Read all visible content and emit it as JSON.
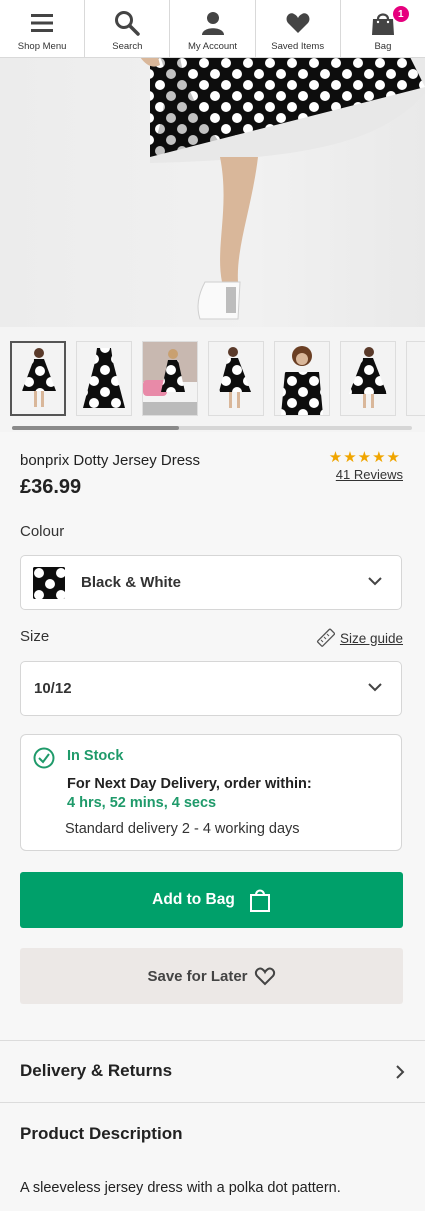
{
  "nav": {
    "items": [
      {
        "label": "Shop Menu",
        "icon": "hamburger-menu-icon"
      },
      {
        "label": "Search",
        "icon": "search-icon"
      },
      {
        "label": "My Account",
        "icon": "user-icon"
      },
      {
        "label": "Saved Items",
        "icon": "heart-icon"
      },
      {
        "label": "Bag",
        "icon": "bag-icon"
      }
    ],
    "bag_count": "1"
  },
  "product": {
    "title": "bonprix Dotty Jersey Dress",
    "price": "£36.99",
    "rating_stars": "★★★★★",
    "rating": 5,
    "reviews": "41 Reviews"
  },
  "colour": {
    "label": "Colour",
    "selected": "Black & White"
  },
  "size": {
    "label": "Size",
    "guide": "Size guide",
    "selected": "10/12"
  },
  "stock": {
    "status": "In Stock",
    "delivery_line": "For Next Day Delivery, order within:",
    "countdown": "4 hrs, 52 mins, 4 secs",
    "standard": "Standard delivery 2 - 4 working days"
  },
  "buttons": {
    "add_to_bag": "Add to Bag",
    "save_for_later": "Save for Later"
  },
  "sections": {
    "delivery_returns": "Delivery & Returns",
    "product_description": "Product Description",
    "description_text": "A sleeveless jersey dress with a polka dot pattern."
  },
  "colors": {
    "accent_green": "#00a06a",
    "stock_green": "#1f9a6a",
    "badge_pink": "#e6007e",
    "star_gold": "#f0a500"
  },
  "thumbnails": {
    "count": 7,
    "selected_index": 0
  }
}
